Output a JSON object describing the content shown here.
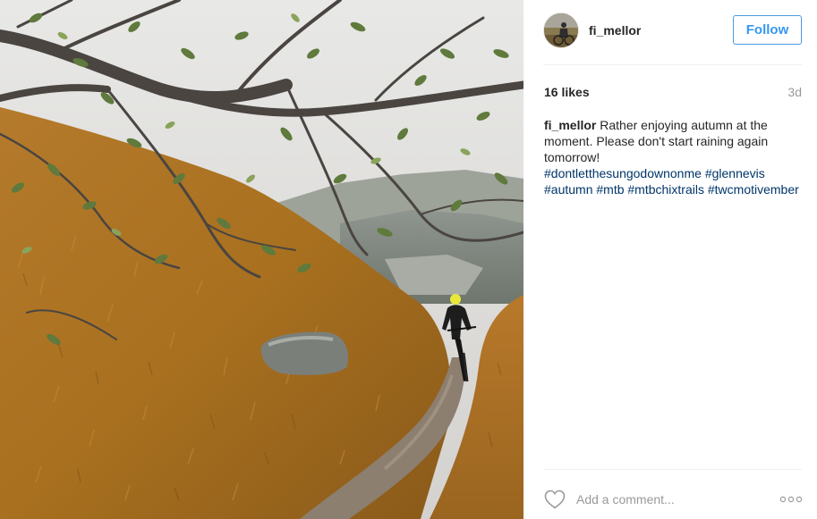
{
  "post": {
    "username": "fi_mellor",
    "follow_label": "Follow",
    "likes": "16 likes",
    "timestamp": "3d",
    "caption": {
      "author": "fi_mellor",
      "text": "Rather enjoying autumn at the moment. Please don't start raining again tomorrow!",
      "hashtags": [
        "#dontletthesungodownonme",
        "#glennevis",
        "#autumn",
        "#mtb",
        "#mtbchixtrails",
        "#twcmotivember"
      ]
    },
    "comment_placeholder": "Add a comment...",
    "icons": {
      "like": "heart-outline-icon",
      "more": "more-options-icon"
    }
  },
  "colors": {
    "follow_blue": "#3897f0",
    "hashtag": "#003569",
    "muted": "#999999",
    "text": "#262626"
  }
}
